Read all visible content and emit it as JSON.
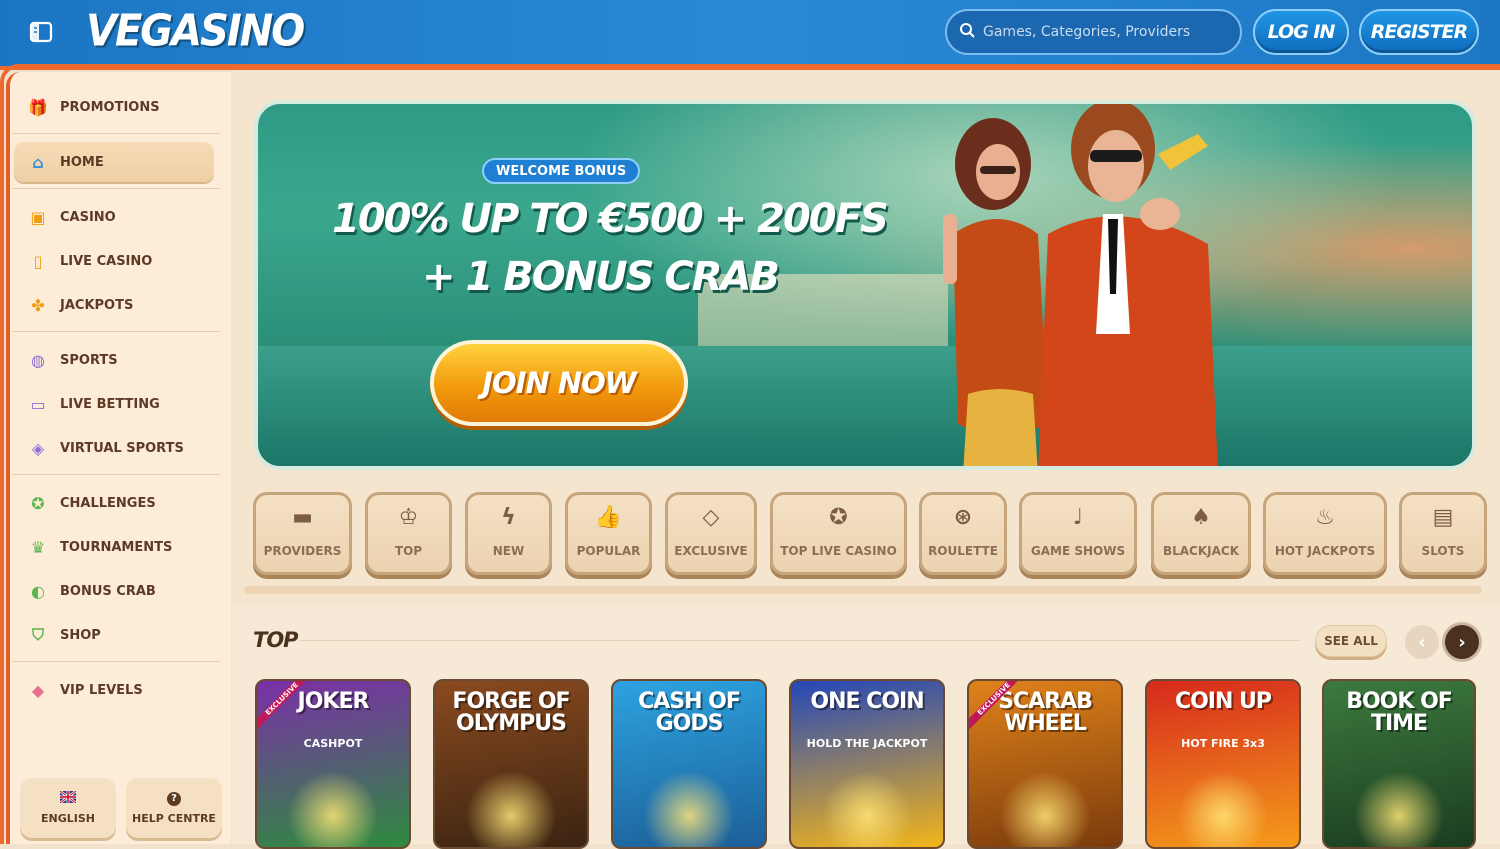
{
  "header": {
    "logo": "VEGASINO",
    "search_placeholder": "Games, Categories, Providers",
    "login_label": "LOG IN",
    "register_label": "REGISTER"
  },
  "sidebar": {
    "items": [
      {
        "label": "PROMOTIONS",
        "icon": "gift-icon",
        "color": "#e5474d"
      },
      {
        "label": "HOME",
        "icon": "home-icon",
        "color": "#3a8fdc"
      },
      {
        "label": "CASINO",
        "icon": "slot-machine-icon",
        "color": "#f39c12"
      },
      {
        "label": "LIVE CASINO",
        "icon": "cards-icon",
        "color": "#f39c12"
      },
      {
        "label": "JACKPOTS",
        "icon": "clover-icon",
        "color": "#f39c12"
      },
      {
        "label": "SPORTS",
        "icon": "ball-icon",
        "color": "#8e6fd8"
      },
      {
        "label": "LIVE BETTING",
        "icon": "live-icon",
        "color": "#8e6fd8"
      },
      {
        "label": "VIRTUAL SPORTS",
        "icon": "virtual-icon",
        "color": "#8e6fd8"
      },
      {
        "label": "CHALLENGES",
        "icon": "medal-icon",
        "color": "#5fb54d"
      },
      {
        "label": "TOURNAMENTS",
        "icon": "trophy-icon",
        "color": "#5fb54d"
      },
      {
        "label": "BONUS CRAB",
        "icon": "crab-icon",
        "color": "#5fb54d"
      },
      {
        "label": "SHOP",
        "icon": "basket-icon",
        "color": "#5fb54d"
      },
      {
        "label": "VIP LEVELS",
        "icon": "diamond-icon",
        "color": "#e5718f"
      }
    ],
    "language_label": "ENGLISH",
    "help_label": "HELP CENTRE"
  },
  "banner": {
    "badge": "WELCOME BONUS",
    "line1": "100% UP TO €500 + 200FS",
    "line2": "+ 1 BONUS CRAB",
    "cta": "JOIN NOW"
  },
  "categories": [
    {
      "label": "PROVIDERS",
      "icon": "folder-icon"
    },
    {
      "label": "TOP",
      "icon": "crown-icon"
    },
    {
      "label": "NEW",
      "icon": "lightning-icon"
    },
    {
      "label": "POPULAR",
      "icon": "thumbs-up-icon"
    },
    {
      "label": "EXCLUSIVE",
      "icon": "diamond-icon"
    },
    {
      "label": "TOP LIVE CASINO",
      "icon": "award-icon"
    },
    {
      "label": "ROULETTE",
      "icon": "roulette-icon"
    },
    {
      "label": "GAME SHOWS",
      "icon": "microphone-icon"
    },
    {
      "label": "BLACKJACK",
      "icon": "spade-icon"
    },
    {
      "label": "HOT JACKPOTS",
      "icon": "fire-icon"
    },
    {
      "label": "SLOTS",
      "icon": "slots-icon"
    }
  ],
  "section": {
    "title": "TOP",
    "see_all": "SEE ALL"
  },
  "games": [
    {
      "title": "JOKER",
      "subtitle": "CASHPOT",
      "badge": "EXCLUSIVE",
      "colors": [
        "#7b2fa8",
        "#2e8b3f"
      ]
    },
    {
      "title": "FORGE OF OLYMPUS",
      "subtitle": "",
      "badge": "",
      "colors": [
        "#8a4a1f",
        "#3b2412"
      ]
    },
    {
      "title": "CASH OF GODS",
      "subtitle": "",
      "badge": "",
      "colors": [
        "#2da3e0",
        "#1c5f98"
      ]
    },
    {
      "title": "ONE COIN",
      "subtitle": "HOLD THE JACKPOT",
      "badge": "",
      "colors": [
        "#2447b8",
        "#f3b51a"
      ]
    },
    {
      "title": "SCARAB WHEEL",
      "subtitle": "",
      "badge": "EXCLUSIVE",
      "colors": [
        "#e0821a",
        "#7b3b0c"
      ]
    },
    {
      "title": "COIN UP",
      "subtitle": "HOT FIRE 3x3",
      "badge": "",
      "colors": [
        "#d62a1c",
        "#f59b1b"
      ]
    },
    {
      "title": "BOOK OF TIME",
      "subtitle": "",
      "badge": "",
      "colors": [
        "#3c7a3e",
        "#1b3c20"
      ]
    }
  ]
}
